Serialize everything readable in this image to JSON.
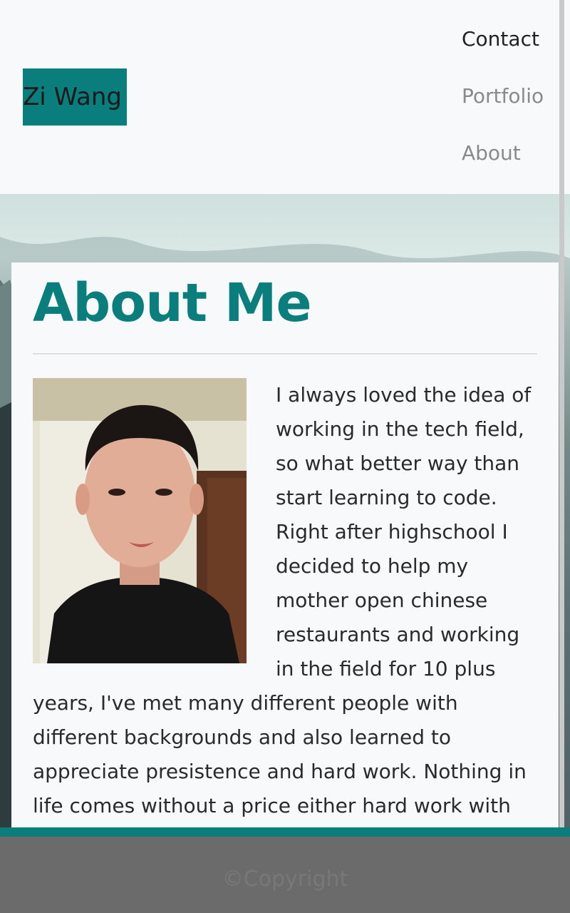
{
  "header": {
    "brand": "Zi Wang",
    "nav": [
      {
        "label": "Contact",
        "active": true
      },
      {
        "label": "Portfolio",
        "active": false
      },
      {
        "label": "About",
        "active": false
      }
    ]
  },
  "about": {
    "title": "About Me",
    "paragraph": "I always loved the idea of working in the tech field, so what better way than start learning to code. Right after highschool I decided to help my mother open chinese restaurants and working in the field for 10 plus years, I've met many different people with different backgrounds and also learned to appreciate presistence and hard work. Nothing in life comes without a price either hard work with"
  },
  "footer": {
    "copyright": "©Copyright"
  },
  "colors": {
    "accent": "#0a7e7c",
    "page_bg": "#f8f9fa",
    "footer_bg": "#6b6b6b"
  }
}
